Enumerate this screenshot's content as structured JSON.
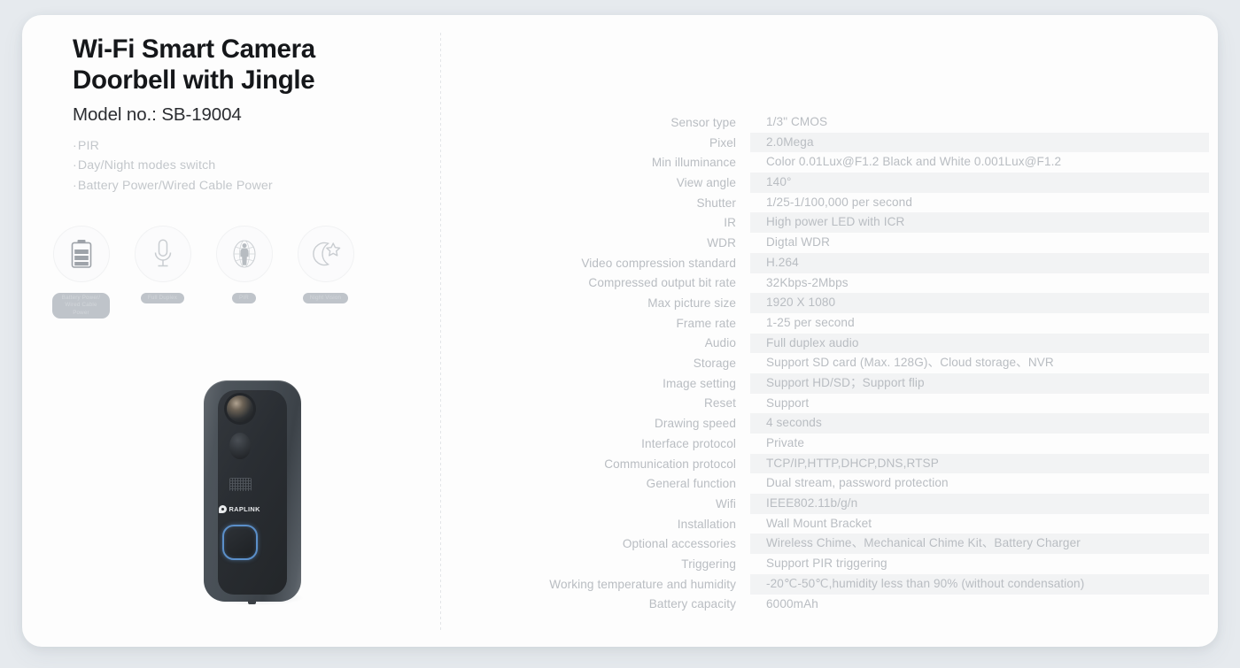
{
  "product": {
    "title": "Wi-Fi Smart Camera Doorbell with Jingle",
    "model": "Model no.: SB-19004",
    "highlights": [
      "PIR",
      "Day/Night modes switch",
      "Battery Power/Wired Cable Power"
    ],
    "brand": "RAPLINK"
  },
  "features": [
    {
      "icon": "battery-icon",
      "label": "Battery Power/\nWired Cable Power"
    },
    {
      "icon": "microphone-icon",
      "label": "Full Duplex"
    },
    {
      "icon": "pir-sensor-icon",
      "label": "PIR"
    },
    {
      "icon": "moon-star-icon",
      "label": "Night Vision"
    }
  ],
  "specs": [
    {
      "label": "Sensor type",
      "value": "1/3\" CMOS"
    },
    {
      "label": "Pixel",
      "value": "2.0Mega"
    },
    {
      "label": "Min illuminance",
      "value": "Color 0.01Lux@F1.2 Black and White 0.001Lux@F1.2"
    },
    {
      "label": "View angle",
      "value": "140°"
    },
    {
      "label": "Shutter",
      "value": "1/25-1/100,000 per second"
    },
    {
      "label": "IR",
      "value": "High power LED with ICR"
    },
    {
      "label": "WDR",
      "value": "Digtal WDR"
    },
    {
      "label": "Video compression standard",
      "value": "H.264"
    },
    {
      "label": "Compressed output bit rate",
      "value": "32Kbps-2Mbps"
    },
    {
      "label": "Max picture size",
      "value": "1920 X 1080"
    },
    {
      "label": "Frame rate",
      "value": "1-25 per second"
    },
    {
      "label": "Audio",
      "value": "Full duplex audio"
    },
    {
      "label": "Storage",
      "value": "Support SD card (Max. 128G)、Cloud storage、NVR"
    },
    {
      "label": "Image setting",
      "value": "Support HD/SD；Support flip"
    },
    {
      "label": "Reset",
      "value": "Support"
    },
    {
      "label": "Drawing speed",
      "value": "4 seconds"
    },
    {
      "label": "Interface protocol",
      "value": "Private"
    },
    {
      "label": "Communication protocol",
      "value": "TCP/IP,HTTP,DHCP,DNS,RTSP"
    },
    {
      "label": "General function",
      "value": "Dual stream, password protection"
    },
    {
      "label": "Wifi",
      "value": "IEEE802.11b/g/n"
    },
    {
      "label": "Installation",
      "value": "Wall Mount Bracket"
    },
    {
      "label": "Optional accessories",
      "value": "Wireless Chime、Mechanical Chime Kit、Battery Charger"
    },
    {
      "label": "Triggering",
      "value": "Support PIR triggering"
    },
    {
      "label": "Working temperature and humidity",
      "value": "-20℃-50℃,humidity less than 90% (without condensation)"
    },
    {
      "label": "Battery capacity",
      "value": "6000mAh"
    }
  ],
  "colors": {
    "page_background": "#e6eaee",
    "card_background": "#fdfdfd",
    "title_text": "#15171a",
    "muted_text": "#b9bdc2",
    "stripe": "#f2f3f4",
    "button_accent": "#5b8fc9"
  }
}
